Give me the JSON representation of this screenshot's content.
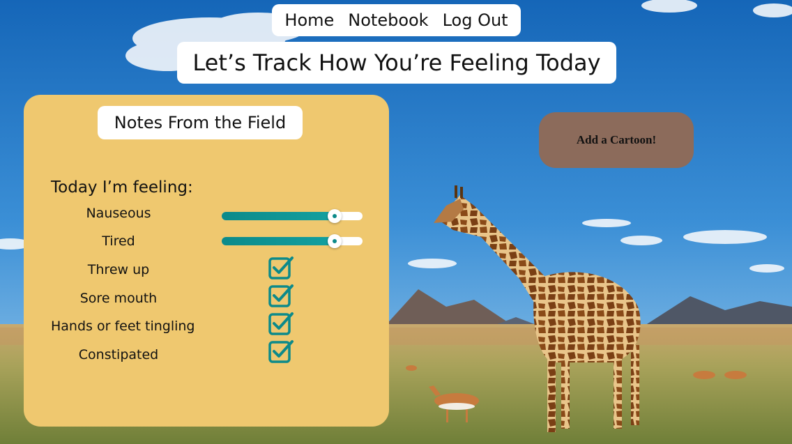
{
  "nav": {
    "home": "Home",
    "notebook": "Notebook",
    "logout": "Log Out"
  },
  "page_title": "Let’s Track How You’re Feeling Today",
  "panel": {
    "title": "Notes From the Field",
    "prompt": "Today I’m feeling:",
    "symptoms": [
      {
        "label": "Nauseous",
        "type": "slider",
        "value_fraction": 0.8
      },
      {
        "label": "Tired",
        "type": "slider",
        "value_fraction": 0.8
      },
      {
        "label": "Threw up",
        "type": "checkbox",
        "checked": true
      },
      {
        "label": "Sore mouth",
        "type": "checkbox",
        "checked": true
      },
      {
        "label": "Hands or feet tingling",
        "type": "checkbox",
        "checked": true
      },
      {
        "label": "Constipated",
        "type": "checkbox",
        "checked": true
      }
    ]
  },
  "cartoon_button": "Add a Cartoon!",
  "colors": {
    "panel": "#efc86f",
    "accent": "#0c8a8a",
    "cartoon_button": "#8c6b5b"
  },
  "background": "savanna-giraffe-photo"
}
